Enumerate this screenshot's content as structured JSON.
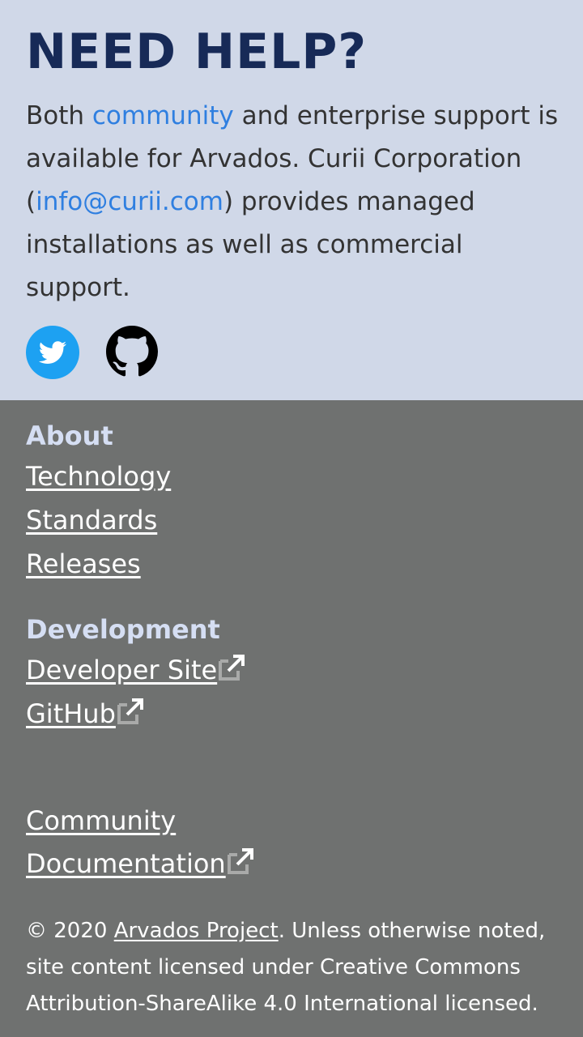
{
  "help": {
    "title": "NEED HELP?",
    "text_1": "Both ",
    "community_link": "community",
    "text_2": " and enterprise support is available for Arvados. Curii Corporation (",
    "email_link": "info@curii.com",
    "text_3": ") provides managed installations as well as commercial support."
  },
  "social": {
    "twitter_icon": "twitter-icon",
    "github_icon": "github-icon",
    "twitter_color": "#1da1f2",
    "github_color": "#000000"
  },
  "footer": {
    "about_heading": "About",
    "about_links": [
      "Technology",
      "Standards",
      "Releases"
    ],
    "development_heading": "Development",
    "developer_site": "Developer Site",
    "github": "GitHub",
    "community": "Community",
    "documentation": "Documentation",
    "external_icon": "external-link-icon"
  },
  "copyright": {
    "prefix": "© 2020 ",
    "project_link": "Arvados Project",
    "suffix": ". Unless otherwise noted, site content licensed under Creative Commons Attribution-ShareAlike 4.0 International licensed."
  },
  "colors": {
    "help_bg": "#d0d8e8",
    "title": "#172a57",
    "link": "#2f7fe0",
    "footer_bg": "#6f7170",
    "footer_heading": "#d5def3"
  }
}
